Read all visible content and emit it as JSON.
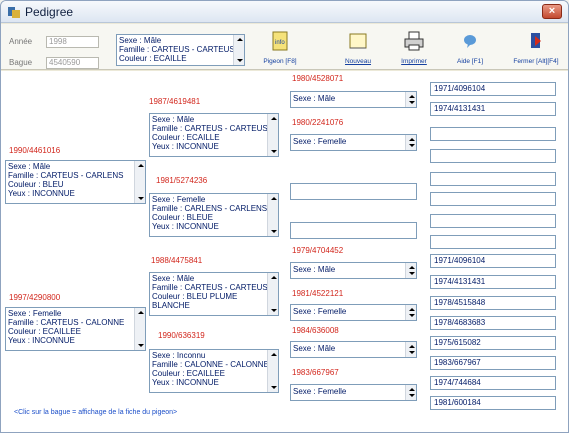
{
  "window": {
    "title": "Pedigree",
    "close": "×"
  },
  "filter": {
    "annee_label": "Année",
    "annee_value": "1998",
    "bague_label": "Bague",
    "bague_value": "4540590",
    "info_lines": [
      "Sexe : Mâle",
      "Famille : CARTEUS - CARTEUS",
      "Couleur : ECAILLE"
    ]
  },
  "toolbar": {
    "pigeon": "Pigeon [F8]",
    "nouveau": "Nouveau",
    "imprimer": "Imprimer",
    "aide": "Aide [F1]",
    "fermer": "Fermer [Alt][F4]"
  },
  "birds": [
    {
      "ring": "1987/4619481",
      "lines": [
        "Sexe : Mâle",
        "Famille : CARTEUS - CARTEUS",
        "Couleur : ECAILLE",
        "Yeux : INCONNUE"
      ]
    },
    {
      "ring": "1990/4461016",
      "lines": [
        "Sexe : Mâle",
        "Famille : CARTEUS - CARLENS",
        "Couleur : BLEU",
        "Yeux : INCONNUE"
      ]
    },
    {
      "ring": "1981/5274236",
      "lines": [
        "Sexe : Femelle",
        "Famille : CARLENS - CARLENS",
        "Couleur : BLEUE",
        "Yeux : INCONNUE"
      ]
    },
    {
      "ring": "1988/4475841",
      "lines": [
        "Sexe : Mâle",
        "Famille : CARTEUS - CARTEUS",
        "Couleur : BLEU PLUME",
        "BLANCHE"
      ]
    },
    {
      "ring": "1997/4290800",
      "lines": [
        "Sexe : Femelle",
        "Famille : CARTEUS - CALONNE",
        "Couleur : ECAILLEE",
        "Yeux : INCONNUE"
      ]
    },
    {
      "ring": "1990/636319",
      "lines": [
        "Sexe : Inconnu",
        "Famille : CALONNE - CALONNE",
        "Couleur : ECAILLEE",
        "Yeux : INCONNUE"
      ]
    }
  ],
  "grand": [
    {
      "ring": "1980/4528071",
      "sex": "Sexe : Mâle"
    },
    {
      "ring": "1980/2241076",
      "sex": "Sexe : Femelle"
    },
    {
      "ring": "1979/4704452",
      "sex": "Sexe : Mâle"
    },
    {
      "ring": "1981/4522121",
      "sex": "Sexe : Femelle"
    },
    {
      "ring": "1984/636008",
      "sex": "Sexe : Mâle"
    },
    {
      "ring": "1983/667967",
      "sex": "Sexe : Femelle"
    }
  ],
  "ancestors": [
    "1971/4096104",
    "1974/4131431",
    "",
    "",
    "",
    "",
    "",
    "",
    "1971/4096104",
    "1974/4131431",
    "1978/4515848",
    "1978/4683683",
    "1975/615082",
    "1983/667967",
    "1974/744684",
    "1981/600184"
  ],
  "hint": "<Clic sur la bague = affichage de la fiche du pigeon>"
}
